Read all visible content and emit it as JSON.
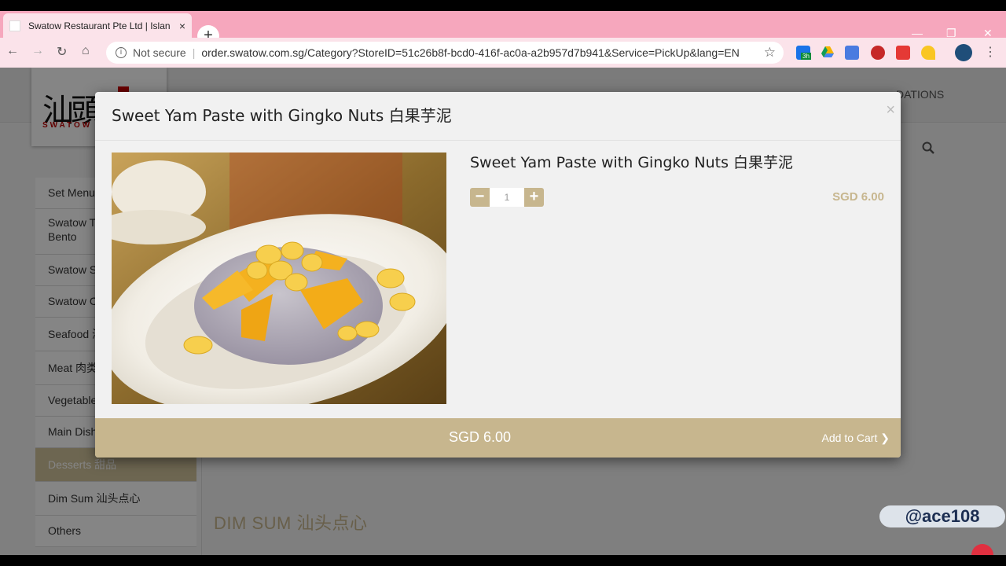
{
  "browser": {
    "tab_title": "Swatow Restaurant Pte Ltd | Islan",
    "tab_close": "×",
    "new_tab": "+",
    "not_secure": "Not secure",
    "separator": "|",
    "url": "order.swatow.com.sg/Category?StoreID=51c26b8f-bcd0-416f-ac0a-a2b957d7b941&Service=PickUp&lang=EN",
    "ext_badge": "3h",
    "info_glyph": "i",
    "star_glyph": "☆",
    "back_glyph": "←",
    "forward_glyph": "→",
    "reload_glyph": "↻",
    "home_glyph": "⌂",
    "menu_glyph": "⋮",
    "minimize_glyph": "—",
    "restore_glyph": "❐",
    "close_glyph": "✕",
    "colors": {
      "tabstrip": "#f6a7bd",
      "toolbar": "#fbe3ea"
    }
  },
  "site": {
    "logo_mark": "汕頭",
    "logo_word": "SWATOW",
    "header_nav_fragment": "DATIONS"
  },
  "sidebar": {
    "items": [
      {
        "label": "Set Menu"
      },
      {
        "label": "Swatow T\nBento"
      },
      {
        "label": "Swatow S"
      },
      {
        "label": "Swatow C"
      },
      {
        "label": "Seafood 海"
      },
      {
        "label": "Meat 肉类"
      },
      {
        "label": "Vegetable"
      },
      {
        "label": "Main Dish"
      },
      {
        "label": "Desserts 甜品"
      },
      {
        "label": "Dim Sum 汕头点心"
      },
      {
        "label": "Others"
      }
    ]
  },
  "main": {
    "section_heading": "DIM SUM 汕头点心"
  },
  "modal": {
    "title": "Sweet Yam Paste with Gingko Nuts 白果芋泥",
    "close": "×",
    "item_name": "Sweet Yam Paste with Gingko Nuts 白果芋泥",
    "quantity": "1",
    "minus": "−",
    "plus": "+",
    "price": "SGD 6.00",
    "footer_price": "SGD 6.00",
    "add_to_cart": "Add to Cart",
    "add_to_cart_chevron": "❯",
    "accent_color": "#c7b68e"
  },
  "watermark": {
    "handle": "@ace108"
  }
}
